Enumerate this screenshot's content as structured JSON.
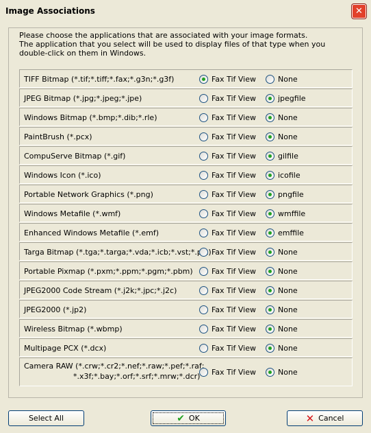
{
  "window": {
    "title": "Image Associations",
    "close_glyph": "✕"
  },
  "intro": {
    "line1": "Please choose the applications that are associated with your image formats.",
    "line2": "The application that you select will be used to display files of that type when you double-click on them in Windows."
  },
  "option_a_label": "Fax Tif View",
  "rows": [
    {
      "format": "TIFF Bitmap (*.tif;*.tiff;*.fax;*.g3n;*.g3f)",
      "alt": "None",
      "selected": "a"
    },
    {
      "format": "JPEG Bitmap (*.jpg;*.jpeg;*.jpe)",
      "alt": "jpegfile",
      "selected": "b"
    },
    {
      "format": "Windows Bitmap (*.bmp;*.dib;*.rle)",
      "alt": "None",
      "selected": "b"
    },
    {
      "format": "PaintBrush (*.pcx)",
      "alt": "None",
      "selected": "b"
    },
    {
      "format": "CompuServe Bitmap (*.gif)",
      "alt": "gilfile",
      "selected": "b"
    },
    {
      "format": "Windows Icon (*.ico)",
      "alt": "icofile",
      "selected": "b"
    },
    {
      "format": "Portable Network Graphics (*.png)",
      "alt": "pngfile",
      "selected": "b"
    },
    {
      "format": "Windows Metafile (*.wmf)",
      "alt": "wmffile",
      "selected": "b"
    },
    {
      "format": "Enhanced Windows Metafile (*.emf)",
      "alt": "emffile",
      "selected": "b"
    },
    {
      "format": "Targa Bitmap (*.tga;*.targa;*.vda;*.icb;*.vst;*.pix)",
      "alt": "None",
      "selected": "b"
    },
    {
      "format": "Portable Pixmap (*.pxm;*.ppm;*.pgm;*.pbm)",
      "alt": "None",
      "selected": "b"
    },
    {
      "format": "JPEG2000 Code Stream (*.j2k;*.jpc;*.j2c)",
      "alt": "None",
      "selected": "b"
    },
    {
      "format": "JPEG2000 (*.jp2)",
      "alt": "None",
      "selected": "b"
    },
    {
      "format": "Wireless Bitmap (*.wbmp)",
      "alt": "None",
      "selected": "b"
    },
    {
      "format": "Multipage PCX (*.dcx)",
      "alt": "None",
      "selected": "b"
    },
    {
      "format": "Camera RAW (*.crw;*.cr2;*.nef;*.raw;*.pef;*.raf;",
      "format_line2": "*.x3f;*.bay;*.orf;*.srf;*.mrw;*.dcr)",
      "alt": "None",
      "selected": "b"
    }
  ],
  "buttons": {
    "select_all": "Select All",
    "ok": "OK",
    "ok_icon": "checkmark-icon",
    "cancel": "Cancel",
    "cancel_icon": "x-icon"
  },
  "colors": {
    "radio_dot": "#21a121",
    "close_red": "#e2412b"
  }
}
